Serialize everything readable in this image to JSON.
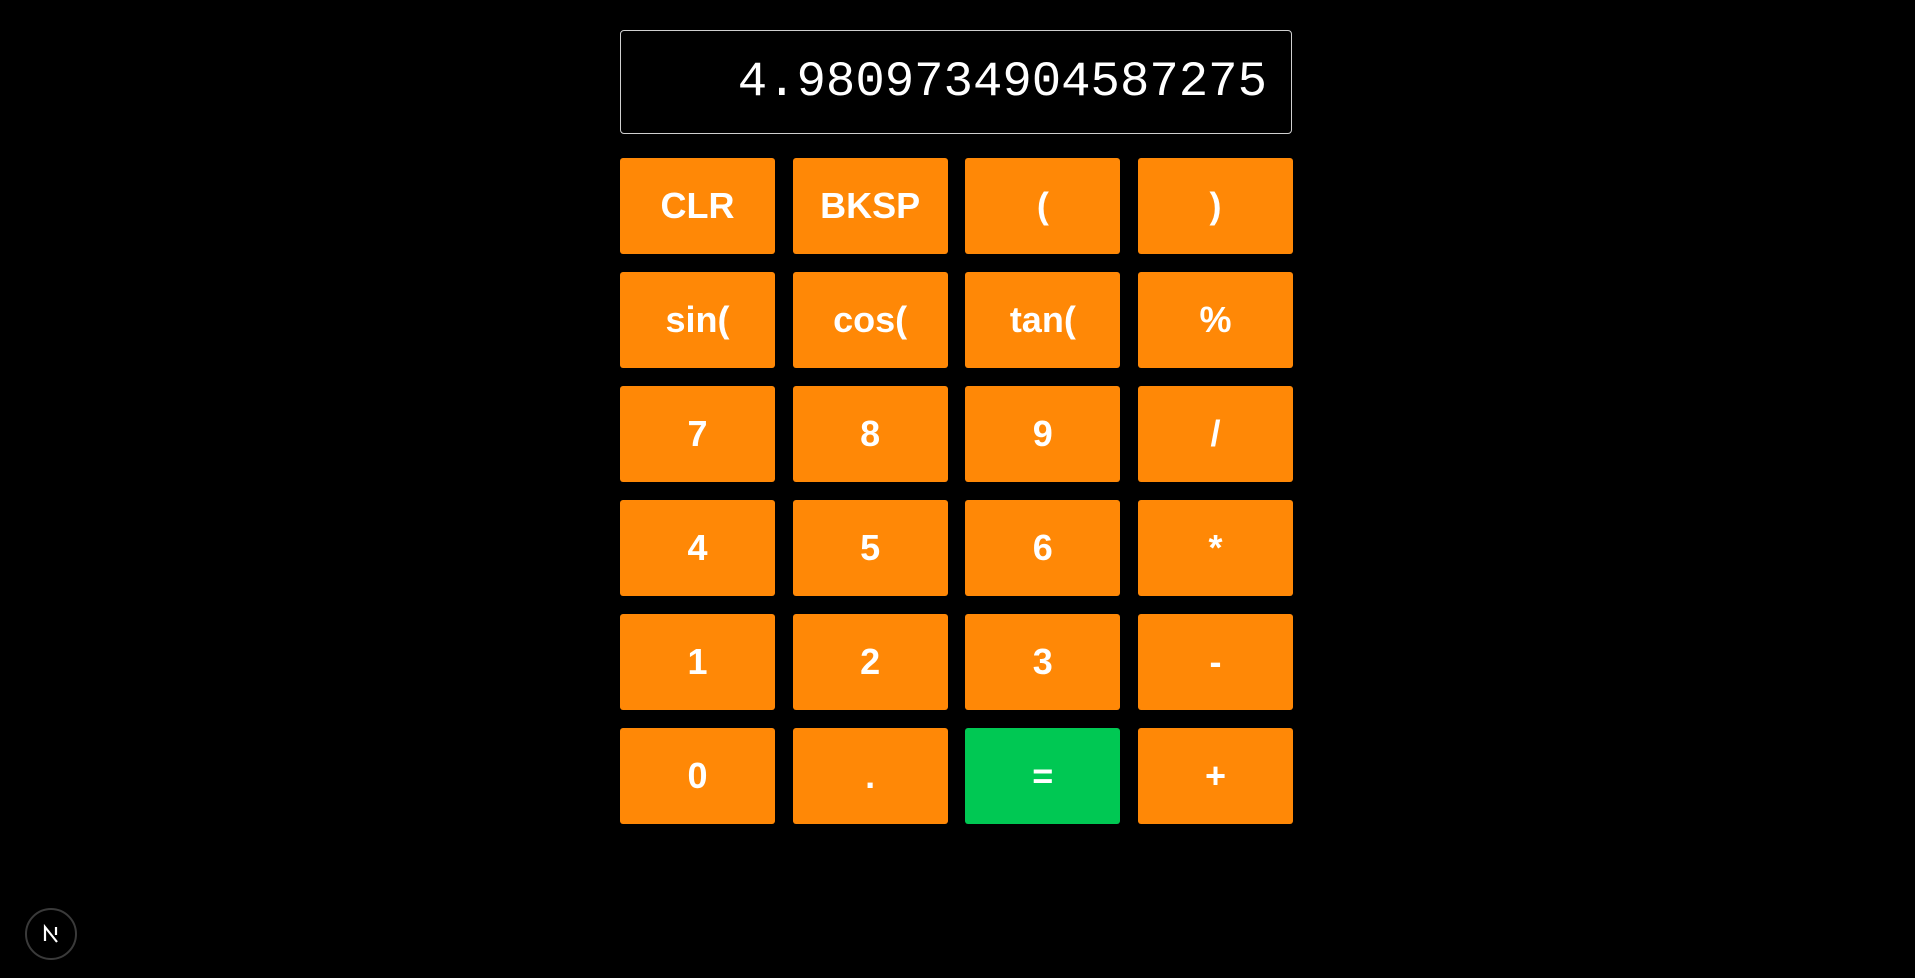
{
  "display": {
    "value": "4.9809734904587275"
  },
  "keypad": {
    "keys": [
      {
        "label": "CLR"
      },
      {
        "label": "BKSP"
      },
      {
        "label": "("
      },
      {
        "label": ")"
      },
      {
        "label": "sin("
      },
      {
        "label": "cos("
      },
      {
        "label": "tan("
      },
      {
        "label": "%"
      },
      {
        "label": "7"
      },
      {
        "label": "8"
      },
      {
        "label": "9"
      },
      {
        "label": "/"
      },
      {
        "label": "4"
      },
      {
        "label": "5"
      },
      {
        "label": "6"
      },
      {
        "label": "*"
      },
      {
        "label": "1"
      },
      {
        "label": "2"
      },
      {
        "label": "3"
      },
      {
        "label": "-"
      },
      {
        "label": "0"
      },
      {
        "label": "."
      },
      {
        "label": "="
      },
      {
        "label": "+"
      }
    ]
  },
  "colors": {
    "key_background": "#ff8806",
    "equals_background": "#00c853",
    "page_background": "#000000"
  },
  "dev_badge": {
    "icon": "nextjs-logo-icon"
  }
}
